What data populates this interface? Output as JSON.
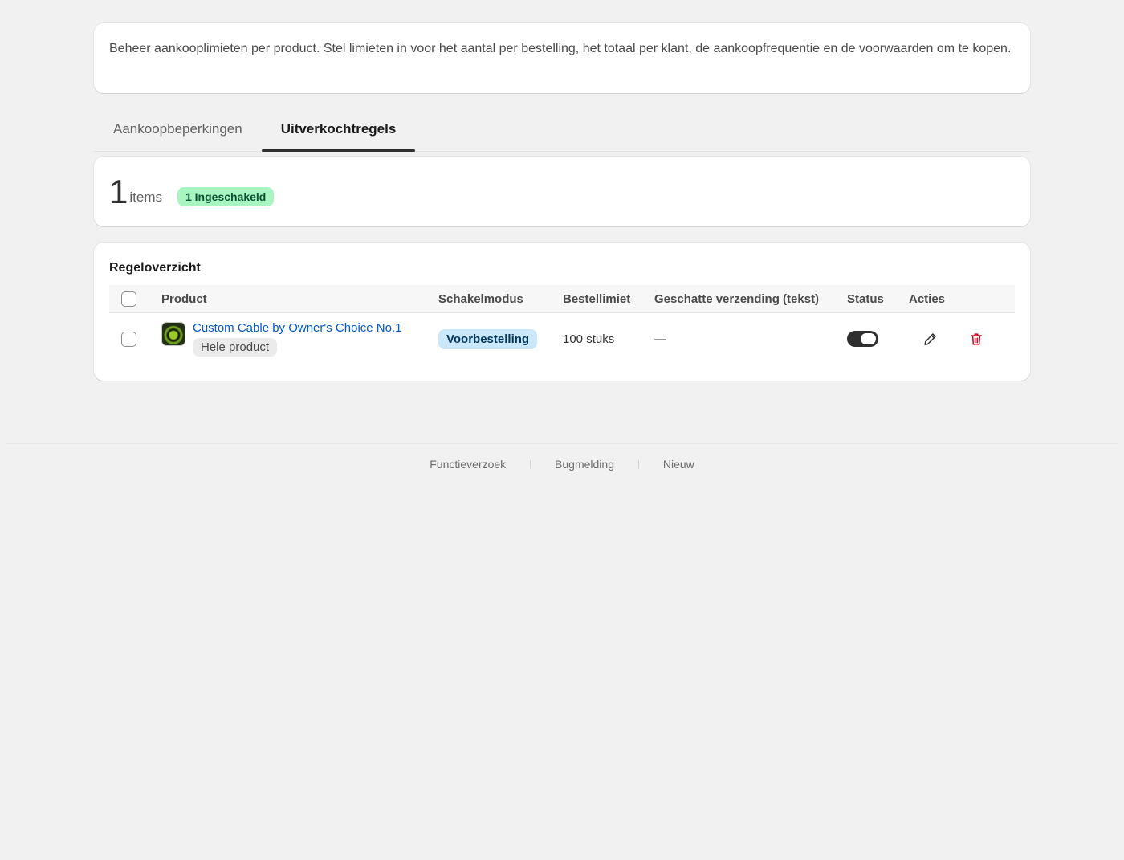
{
  "intro": {
    "text": "Beheer aankooplimieten per product. Stel limieten in voor het aantal per bestelling, het totaal per klant, de aankoopfrequentie en de voorwaarden om te kopen."
  },
  "tabs": [
    {
      "label": "Aankoopbeperkingen",
      "active": false
    },
    {
      "label": "Uitverkochtregels",
      "active": true
    }
  ],
  "summary": {
    "count": "1",
    "count_label": "items",
    "enabled_badge": "1 Ingeschakeld"
  },
  "rules": {
    "title": "Regeloverzicht",
    "columns": {
      "product": "Product",
      "mode": "Schakelmodus",
      "limit": "Bestellimiet",
      "shipping": "Geschatte verzending (tekst)",
      "status": "Status",
      "actions": "Acties"
    },
    "rows": [
      {
        "product_name": "Custom Cable by Owner's Choice No.1",
        "scope": "Hele product",
        "mode": "Voorbestelling",
        "limit": "100 stuks",
        "shipping": "—",
        "status_enabled": true,
        "thumbnail_icon": "product-thumbnail"
      }
    ]
  },
  "footer": {
    "links": [
      "Functieverzoek",
      "Bugmelding",
      "Nieuw"
    ]
  },
  "colors": {
    "link": "#005bd3",
    "enabled_badge_bg": "#a9f5c2",
    "mode_badge_bg": "#cbe8fb",
    "delete_icon": "#c70a24",
    "toggle_on": "#303030"
  }
}
